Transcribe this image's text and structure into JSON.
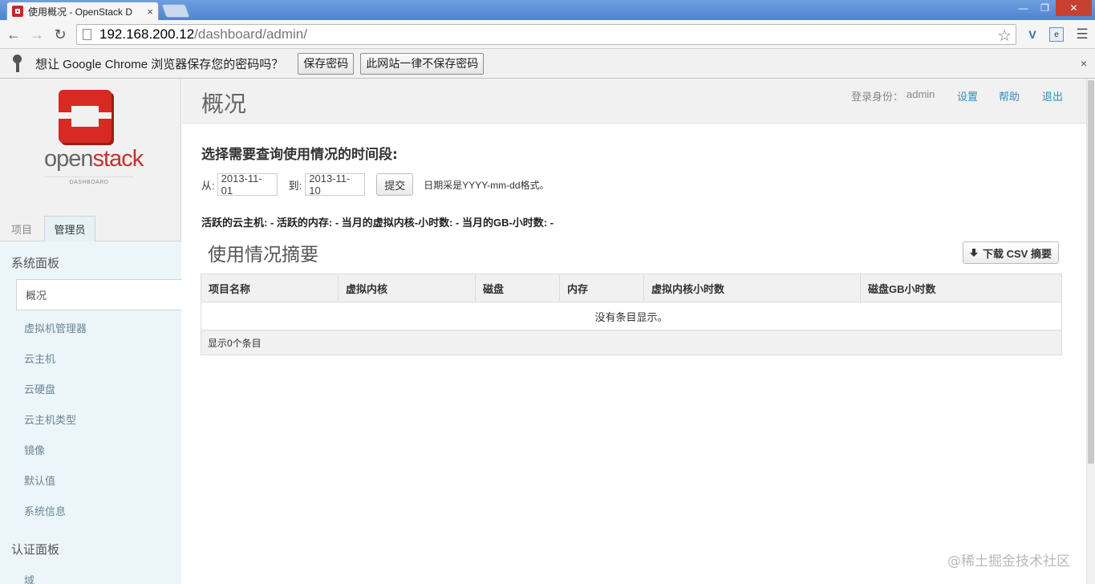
{
  "browser": {
    "tab_title": "使用概况 - OpenStack D",
    "tab_close": "×",
    "url_host": "192.168.200.12",
    "url_path": "/dashboard/admin/",
    "window_controls": [
      "—",
      "❐",
      "✕"
    ]
  },
  "infobar": {
    "message": "想让 Google Chrome 浏览器保存您的密码吗？",
    "save_label": "保存密码",
    "never_label": "此网站一律不保存密码",
    "dismiss": "×"
  },
  "logo": {
    "word_open": "open",
    "word_stack": "stack",
    "sub": "DASHBOARD"
  },
  "sidebar": {
    "tabs": [
      "项目",
      "管理员"
    ],
    "active_tab": "管理员",
    "system_panel": {
      "title": "系统面板",
      "items": [
        "概况",
        "虚拟机管理器",
        "云主机",
        "云硬盘",
        "云主机类型",
        "镜像",
        "默认值",
        "系统信息"
      ],
      "active": "概况"
    },
    "auth_panel": {
      "title": "认证面板",
      "items": [
        "域"
      ]
    }
  },
  "header": {
    "title": "概况",
    "user_label": "登录身份：",
    "user_name": "admin",
    "settings": "设置",
    "help": "帮助",
    "logout": "退出"
  },
  "query": {
    "title": "选择需要查询使用情况的时间段:",
    "from_label": "从:",
    "from_value": "2013-11-01",
    "to_label": "到:",
    "to_value": "2013-11-10",
    "submit_label": "提交",
    "format_hint": "日期采是YYYY-mm-dd格式。"
  },
  "stats": "活跃的云主机: - 活跃的内存: - 当月的虚拟内核-小时数: - 当月的GB-小时数: -",
  "summary": {
    "title": "使用情况摘要",
    "csv_label": "下载 CSV 摘要",
    "columns": [
      "项目名称",
      "虚拟内核",
      "磁盘",
      "内存",
      "虚拟内核小时数",
      "磁盘GB小时数"
    ],
    "empty_text": "没有条目显示。",
    "footer": "显示0个条目"
  },
  "watermark": "@稀土掘金技术社区",
  "colors": {
    "brand_red": "#c6302b",
    "link_blue": "#2f8fbf",
    "sidebar_panel": "#ecf5fa"
  }
}
